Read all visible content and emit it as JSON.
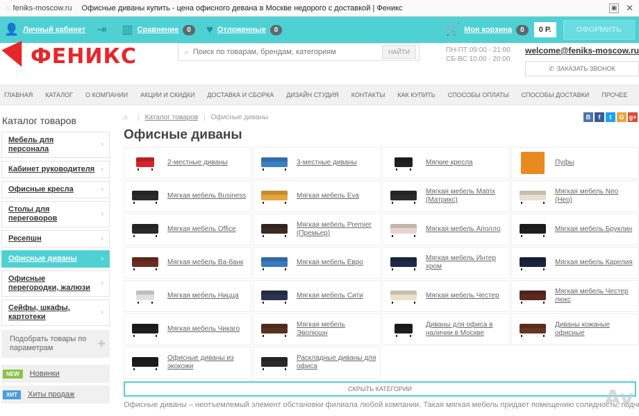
{
  "browser": {
    "host": "feniks-moscow.ru",
    "title": "Офисные диваны купить - цена офисного девана в Москве недорого с доставкой | Феникс"
  },
  "userbar": {
    "account": "Личный кабинет",
    "compare": "Сравнение",
    "compare_count": "0",
    "favorites": "Отложенные",
    "favorites_count": "0",
    "cart": "Моя корзина",
    "cart_count": "0",
    "cart_total": "0 Р.",
    "checkout": "ОФОРМИТЬ"
  },
  "header": {
    "logo": "ФЕНИКС",
    "search_placeholder": "Поиск по товарам, брендам, категориям",
    "search_button": "НАЙТИ",
    "hours_1": "ПН-ПТ 09:00 - 21:00",
    "hours_2": "СБ-ВС 10:00 - 20:00",
    "email": "welcome@feniks-moscow.ru",
    "callback": "ЗАКАЗАТЬ ЗВОНОК"
  },
  "nav": [
    "ГЛАВНАЯ",
    "КАТАЛОГ",
    "О КОМПАНИИ",
    "АКЦИИ И СКИДКИ",
    "ДОСТАВКА И СБОРКА",
    "ДИЗАЙН СТУДИЯ",
    "КОНТАКТЫ",
    "КАК КУПИТЬ",
    "СПОСОБЫ ОПЛАТЫ",
    "СПОСОБЫ ДОСТАВКИ",
    "ПРОЧЕЕ"
  ],
  "sidebar": {
    "title": "Каталог товаров",
    "categories": [
      "Мебель для персонала",
      "Кабинет руководителя",
      "Офисные кресла",
      "Столы для переговоров",
      "Ресепшн",
      "Офисные диваны",
      "Офисные перегородки, жалюзи",
      "Сейфы, шкафы, картотеки"
    ],
    "filter": "Подобрать товары по параметрам",
    "new_tag": "NEW",
    "new_link": "Новинки",
    "hit_tag": "ХИТ",
    "hit_link": "Хиты продаж"
  },
  "breadcrumbs": {
    "catalog": "Каталог товаров",
    "current": "Офисные диваны"
  },
  "social": [
    "В",
    "f",
    "t",
    "G",
    "g+"
  ],
  "page_title": "Офисные диваны",
  "subcategories": [
    {
      "label": "2-местные диваны",
      "color": "#d9232a",
      "type": "chair"
    },
    {
      "label": "3-местные диваны",
      "color": "#3b7fc4",
      "type": "sofa"
    },
    {
      "label": "Мягкие кресла",
      "color": "#222222",
      "type": "chair"
    },
    {
      "label": "Пуфы",
      "color": "#e88a1f",
      "type": "pouf"
    },
    {
      "label": "Мягкая мебель Business",
      "color": "#2a2a2a",
      "type": "sofa"
    },
    {
      "label": "Мягкая мебель Eva",
      "color": "#e6a53a",
      "type": "sofa"
    },
    {
      "label": "Мягкая мебель Matrix (Матрикс)",
      "color": "#2a2a2a",
      "type": "sofa"
    },
    {
      "label": "Мягкая мебель Neo (Нео)",
      "color": "#e8e0d0",
      "type": "sofa"
    },
    {
      "label": "Мягкая мебель Office",
      "color": "#2a2a2a",
      "type": "sofa"
    },
    {
      "label": "Мягкая мебель Premier (Премьер)",
      "color": "#3a2a26",
      "type": "sofa"
    },
    {
      "label": "Мягкая мебель Аполло",
      "color": "#e8d4cc",
      "type": "sofa"
    },
    {
      "label": "Мягкая мебель Бруклин",
      "color": "#1e1e1e",
      "type": "sofa"
    },
    {
      "label": "Мягкая мебель Ва-банк",
      "color": "#6a2e22",
      "type": "sofa"
    },
    {
      "label": "Мягкая мебель Евро",
      "color": "#3a7ac0",
      "type": "sofa"
    },
    {
      "label": "Мягкая мебель Интер хром",
      "color": "#1e2a48",
      "type": "sofa"
    },
    {
      "label": "Мягкая мебель Карелия",
      "color": "#1a2440",
      "type": "sofa"
    },
    {
      "label": "Мягкая мебель Ницца",
      "color": "#e0e0e0",
      "type": "chair"
    },
    {
      "label": "Мягкая мебель Сити",
      "color": "#2a3350",
      "type": "sofa"
    },
    {
      "label": "Мягкая мебель Честер",
      "color": "#e8e2cc",
      "type": "sofa"
    },
    {
      "label": "Мягкая мебель Честер люкс",
      "color": "#5a2a20",
      "type": "sofa"
    },
    {
      "label": "Мягкая мебель Чикаго",
      "color": "#1e1e1e",
      "type": "sofa"
    },
    {
      "label": "Мягкая мебель Эволюшн",
      "color": "#5a3020",
      "type": "sofa"
    },
    {
      "label": "Диваны для офиса в наличии в Москве",
      "color": "#1e1e1e",
      "type": "chair"
    },
    {
      "label": "Диваны кожаные офисные",
      "color": "#6a3424",
      "type": "sofa"
    },
    {
      "label": "Офисные диваны из экокожи",
      "color": "#1e1e1e",
      "type": "sofa"
    },
    {
      "label": "Раскладные диваны для офиса",
      "color": "#2a2a2a",
      "type": "sofa"
    }
  ],
  "hide_button": "СКРЫТЬ КАТЕГОРИИ",
  "description": "Офисные диваны – неотъемлемый элемент обстановки филиала любой компании. Такая мягкая мебель придает помещению солидность, подчеркивая",
  "watermark": "Av"
}
